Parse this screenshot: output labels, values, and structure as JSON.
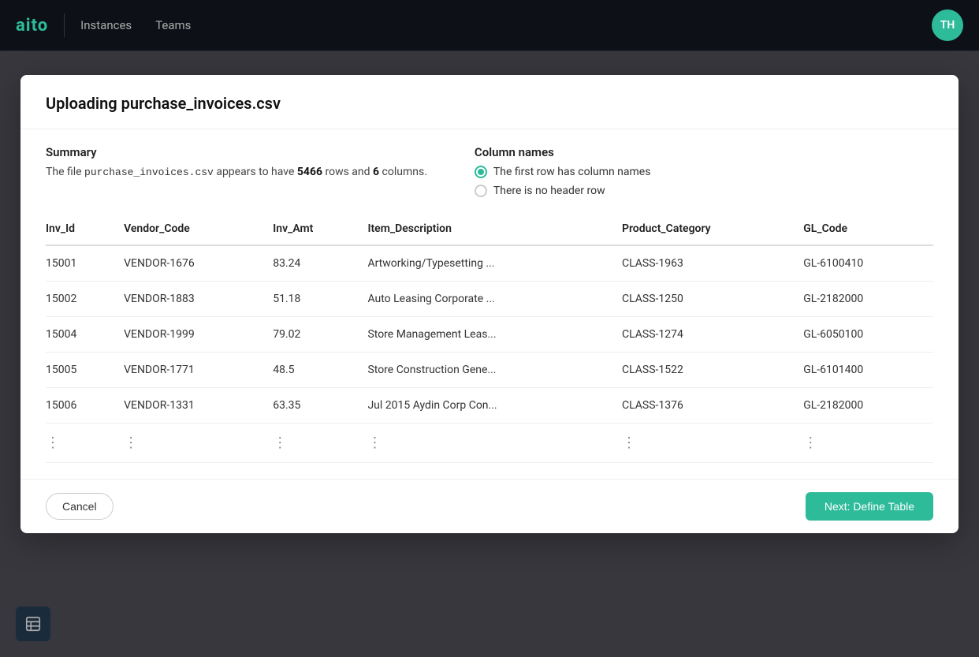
{
  "navbar": {
    "logo": "aito",
    "links": [
      {
        "label": "Instances",
        "id": "instances"
      },
      {
        "label": "Teams",
        "id": "teams"
      }
    ],
    "avatar": {
      "initials": "TH",
      "bg_color": "#2ebb9a"
    }
  },
  "modal": {
    "title": "Uploading purchase_invoices.csv",
    "summary": {
      "heading": "Summary",
      "text_prefix": "The file ",
      "filename": "purchase_invoices.csv",
      "text_middle": " appears to have ",
      "rows": "5466",
      "text_and": " rows and ",
      "columns": "6",
      "text_suffix": " columns."
    },
    "column_names": {
      "heading": "Column names",
      "options": [
        {
          "label": "The first row has column names",
          "selected": true
        },
        {
          "label": "There is no header row",
          "selected": false
        }
      ]
    },
    "table": {
      "headers": [
        "Inv_Id",
        "Vendor_Code",
        "Inv_Amt",
        "Item_Description",
        "Product_Category",
        "GL_Code"
      ],
      "rows": [
        [
          "15001",
          "VENDOR-1676",
          "83.24",
          "Artworking/Typesetting ...",
          "CLASS-1963",
          "GL-6100410"
        ],
        [
          "15002",
          "VENDOR-1883",
          "51.18",
          "Auto Leasing Corporate ...",
          "CLASS-1250",
          "GL-2182000"
        ],
        [
          "15004",
          "VENDOR-1999",
          "79.02",
          "Store Management Leas...",
          "CLASS-1274",
          "GL-6050100"
        ],
        [
          "15005",
          "VENDOR-1771",
          "48.5",
          "Store Construction Gene...",
          "CLASS-1522",
          "GL-6101400"
        ],
        [
          "15006",
          "VENDOR-1331",
          "63.35",
          "Jul 2015 Aydin Corp Con...",
          "CLASS-1376",
          "GL-2182000"
        ]
      ],
      "dots_row": [
        "⋮",
        "⋮",
        "⋮",
        "⋮",
        "⋮",
        "⋮"
      ]
    },
    "footer": {
      "cancel_label": "Cancel",
      "next_label": "Next: Define Table"
    }
  }
}
